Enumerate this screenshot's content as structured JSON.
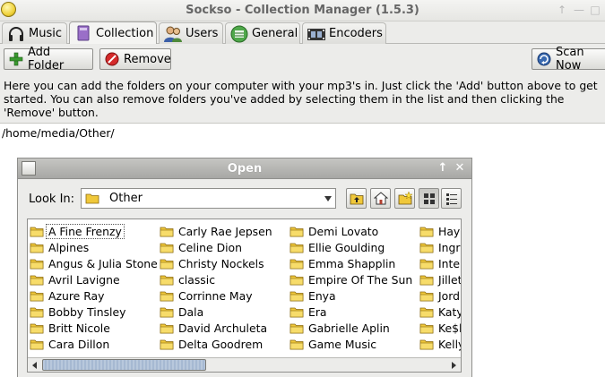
{
  "window": {
    "title": "Sockso - Collection Manager (1.5.3)"
  },
  "tabs": [
    {
      "label": "Music",
      "icon": "headphones-icon"
    },
    {
      "label": "Collection",
      "icon": "collection-icon",
      "active": true
    },
    {
      "label": "Users",
      "icon": "users-icon"
    },
    {
      "label": "General",
      "icon": "general-icon"
    },
    {
      "label": "Encoders",
      "icon": "film-icon"
    }
  ],
  "toolbar": {
    "add_folder_label": "Add Folder",
    "remove_label": "Remove",
    "scan_now_label": "Scan Now"
  },
  "help_text": "Here you can add the folders on your computer with your mp3's in. Just click the 'Add' button above to get started. You can also remove folders you've added by selecting them in the list and then clicking the 'Remove' button.",
  "folders": [
    "/home/media/Other/"
  ],
  "dialog": {
    "title": "Open",
    "look_in_label": "Look In:",
    "look_in_value": "Other",
    "columns": [
      [
        "A Fine Frenzy",
        "Alpines",
        "Angus & Julia Stone",
        "Avril Lavigne",
        "Azure Ray",
        "Bobby Tinsley",
        "Britt Nicole",
        "Cara Dillon"
      ],
      [
        "Carly Rae Jepsen",
        "Celine Dion",
        "Christy Nockels",
        "classic",
        "Corrinne May",
        "Dala",
        "David Archuleta",
        "Delta Goodrem"
      ],
      [
        "Demi Lovato",
        "Ellie Goulding",
        "Emma Shapplin",
        "Empire Of The Sun",
        "Enya",
        "Era",
        "Gabrielle Aplin",
        "Game Music"
      ],
      [
        "Hayl",
        "Ingr",
        "Inte",
        "Jillet",
        "Jord",
        "Katy",
        "Ke$l",
        "Kelly"
      ]
    ],
    "selected_item": "A Fine Frenzy",
    "scroll_position": 0.0
  },
  "colors": {
    "folder": "#f0c83a",
    "accent_thumb": "#a6b9d2"
  }
}
